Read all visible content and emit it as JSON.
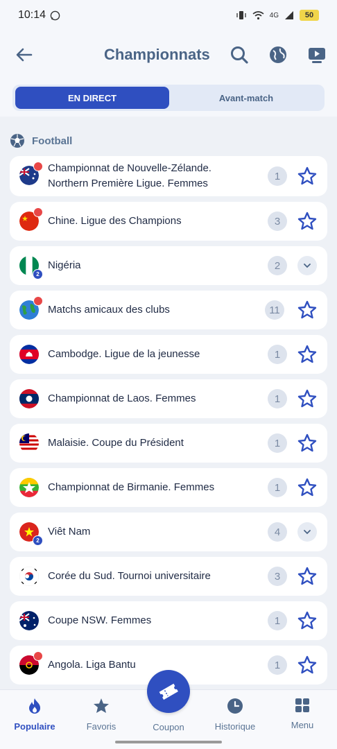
{
  "status": {
    "time": "10:14",
    "battery": "50",
    "network": "4G"
  },
  "header": {
    "title": "Championnats"
  },
  "tabs": {
    "active": "EN DIRECT",
    "inactive": "Avant-match"
  },
  "section": {
    "label": "Football"
  },
  "rows": [
    {
      "label_line1": "Championnat de Nouvelle-Zélande.",
      "label_line2": "Northern Première Ligue. Femmes",
      "count": "1",
      "action": "star",
      "fire": true,
      "flag": "australia-nz"
    },
    {
      "label_line1": "Chine. Ligue des Champions",
      "count": "3",
      "action": "star",
      "fire": true,
      "flag": "china"
    },
    {
      "label_line1": "Nigéria",
      "count": "2",
      "action": "expand",
      "sub": "2",
      "flag": "nigeria"
    },
    {
      "label_line1": "Matchs amicaux des clubs",
      "count": "11",
      "action": "star",
      "fire": true,
      "flag": "world"
    },
    {
      "label_line1": "Cambodge. Ligue de la jeunesse",
      "count": "1",
      "action": "star",
      "flag": "cambodia"
    },
    {
      "label_line1": "Championnat de Laos. Femmes",
      "count": "1",
      "action": "star",
      "flag": "laos"
    },
    {
      "label_line1": "Malaisie. Coupe du Président",
      "count": "1",
      "action": "star",
      "flag": "malaysia"
    },
    {
      "label_line1": "Championnat  de Birmanie. Femmes",
      "count": "1",
      "action": "star",
      "flag": "myanmar"
    },
    {
      "label_line1": "Viêt Nam",
      "count": "4",
      "action": "expand",
      "sub": "2",
      "flag": "vietnam"
    },
    {
      "label_line1": "Corée du Sud. Tournoi universitaire",
      "count": "3",
      "action": "star",
      "flag": "korea"
    },
    {
      "label_line1": "Coupe NSW. Femmes",
      "count": "1",
      "action": "star",
      "flag": "australia"
    },
    {
      "label_line1": "Angola. Liga Bantu",
      "count": "1",
      "action": "star",
      "fire": true,
      "flag": "angola"
    }
  ],
  "nav": {
    "populaire": "Populaire",
    "favoris": "Favoris",
    "coupon": "Coupon",
    "historique": "Historique",
    "menu": "Menu"
  },
  "colors": {
    "accent": "#2f4fc0",
    "title": "#4a6486",
    "background": "#eef1f6",
    "fire": "#e84747"
  }
}
